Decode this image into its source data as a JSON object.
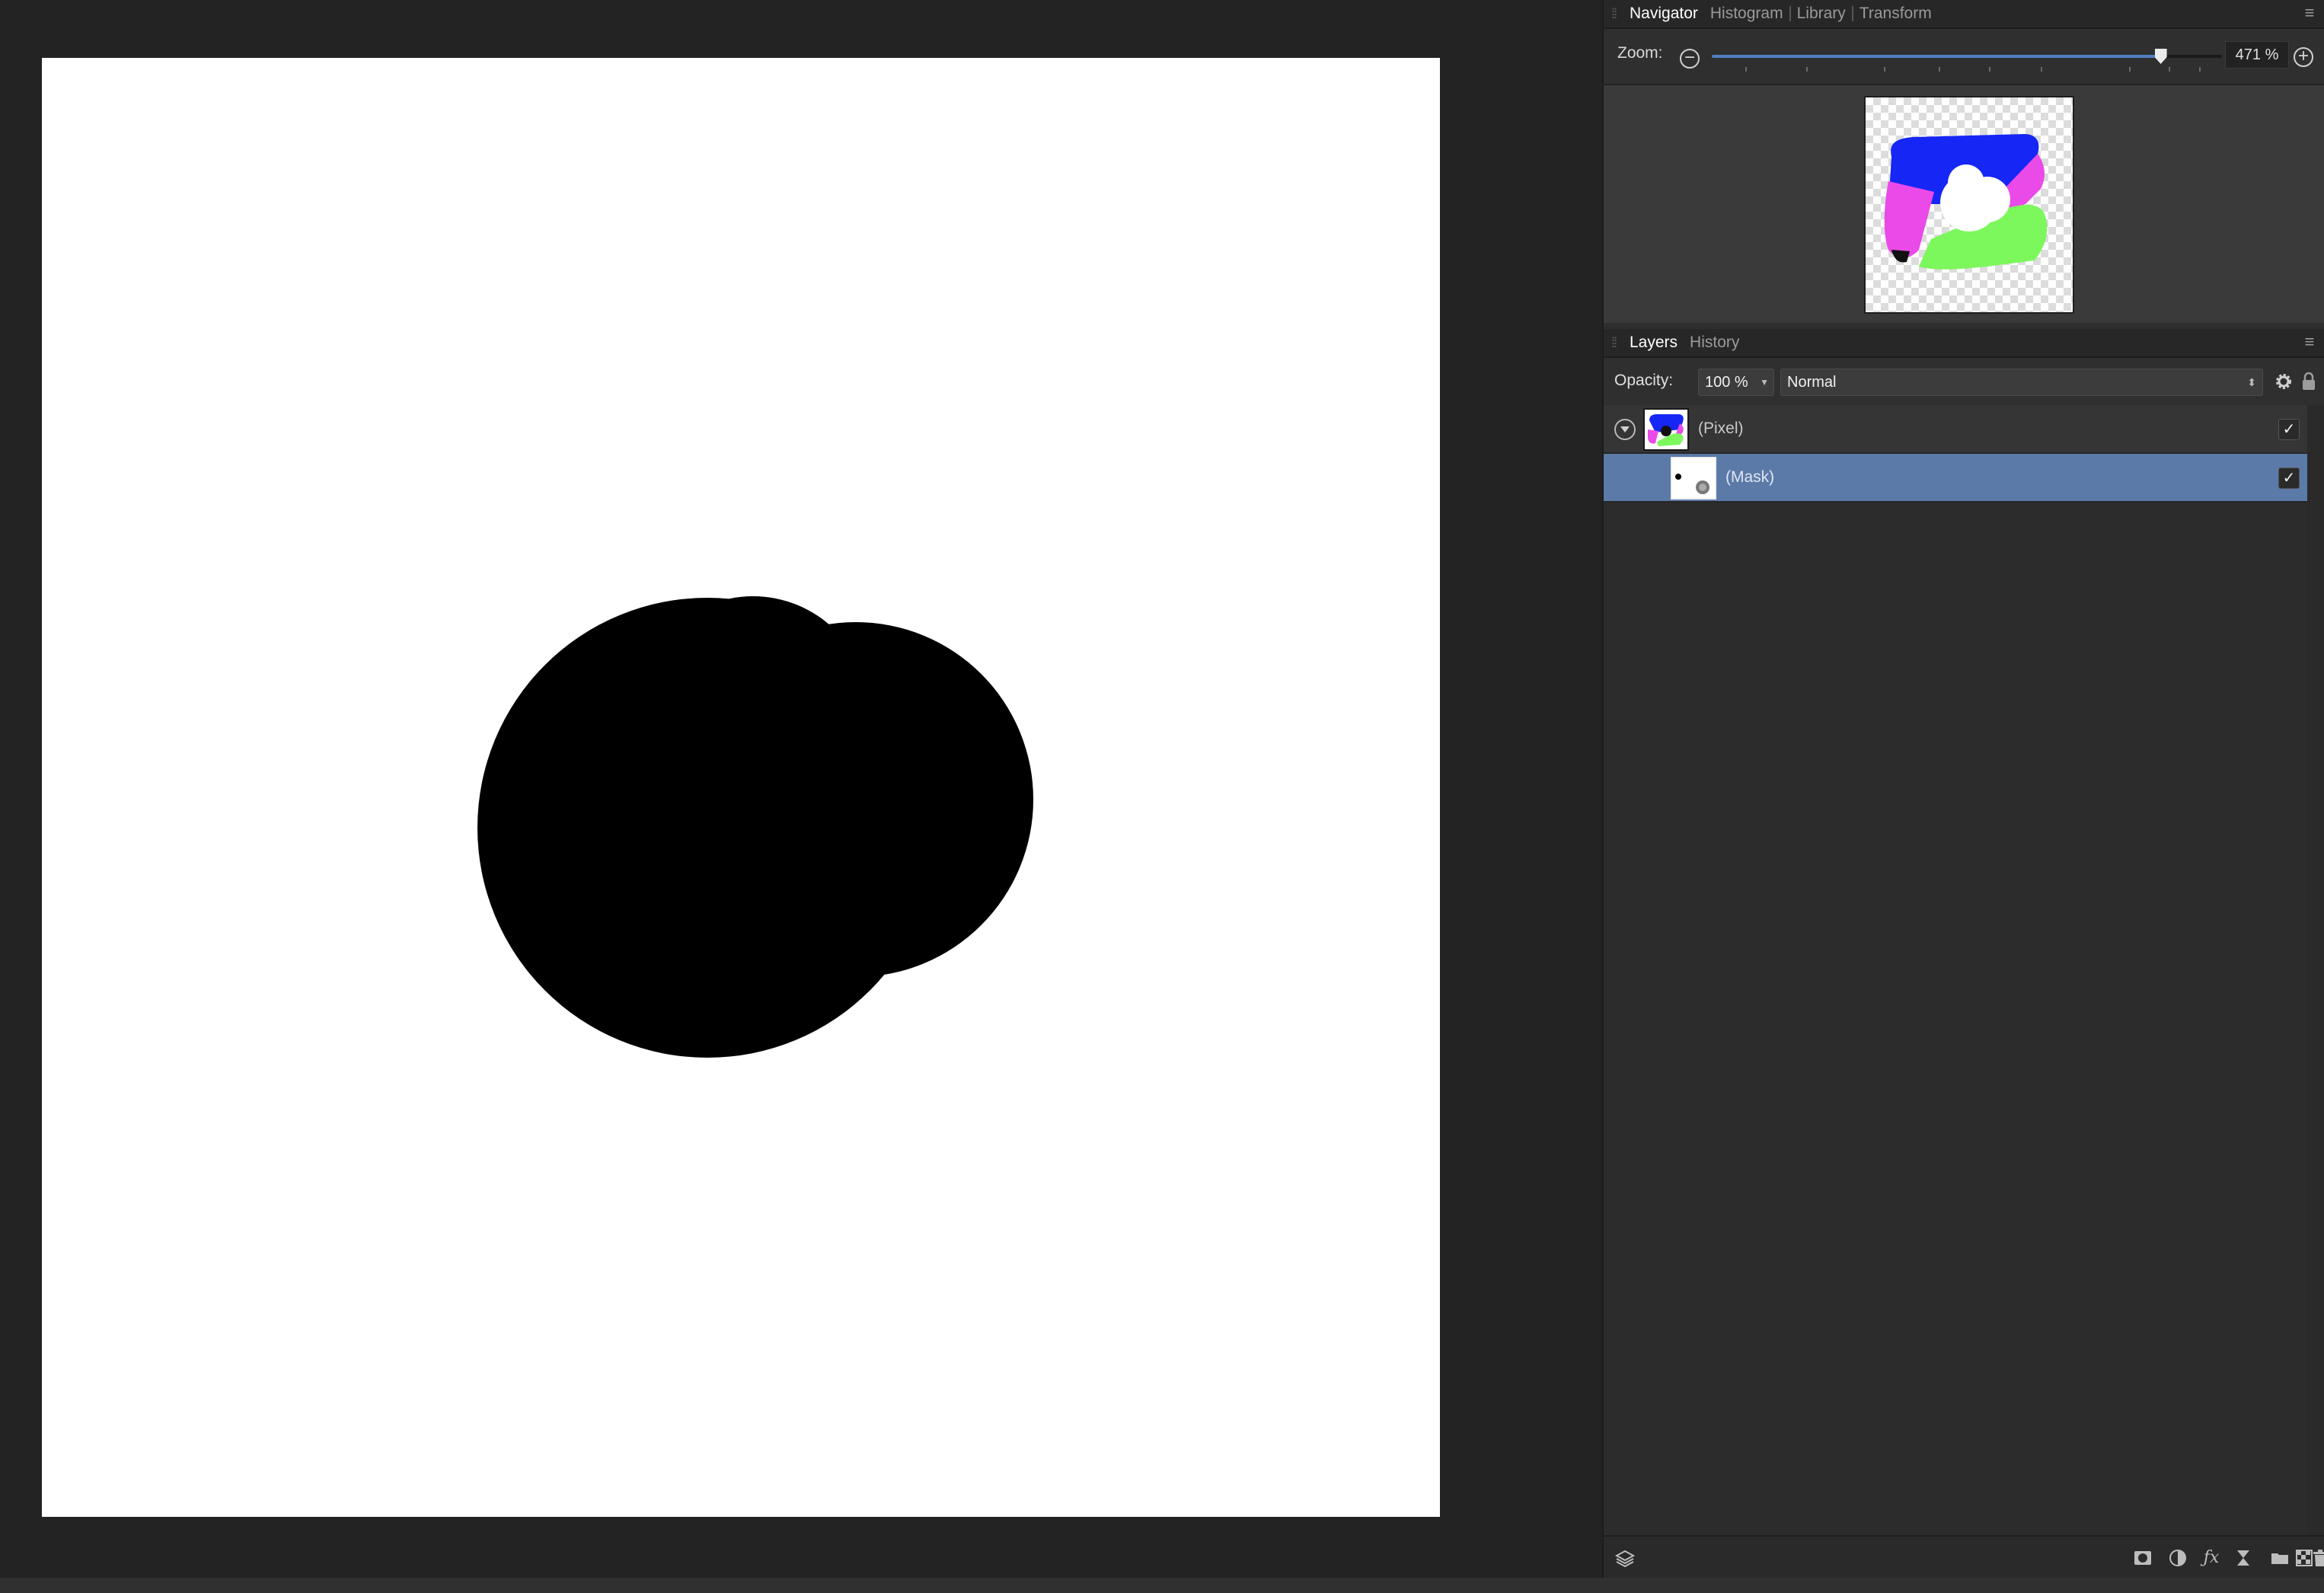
{
  "navigator_panel": {
    "tabs": [
      "Navigator",
      "Histogram",
      "Library",
      "Transform"
    ],
    "active_tab": "Navigator",
    "zoom_label": "Zoom:",
    "zoom_value": "471 %",
    "zoom_slider_fraction": 0.88
  },
  "layers_panel": {
    "tabs": [
      "Layers",
      "History"
    ],
    "active_tab": "Layers",
    "opacity_label": "Opacity:",
    "opacity_value": "100 %",
    "blend_mode": "Normal",
    "layers": [
      {
        "name": "(Pixel)",
        "visible_check": "✓",
        "selected": false
      },
      {
        "name": "(Mask)",
        "visible_check": "✓",
        "selected": true
      }
    ]
  },
  "colors": {
    "canvas_bg": "#ffffff",
    "mask_shape": "#000000",
    "selection": "#5b7aa8",
    "accent": "#4f7ec2",
    "preview_blue": "#1626f4",
    "preview_magenta": "#ea4ae8",
    "preview_green": "#7cf75c"
  },
  "icons": {
    "panel_menu": "hamburger-icon",
    "zoom_out": "minus-circle-icon",
    "zoom_in": "plus-circle-icon",
    "settings": "gear-icon",
    "lock": "lock-icon",
    "expand": "chevron-down-icon",
    "toolbar": [
      "layers-icon",
      "mask-icon",
      "adjustment-icon",
      "fx-icon",
      "live-filter-icon",
      "folder-icon",
      "pixel-layer-icon",
      "trash-icon"
    ]
  }
}
